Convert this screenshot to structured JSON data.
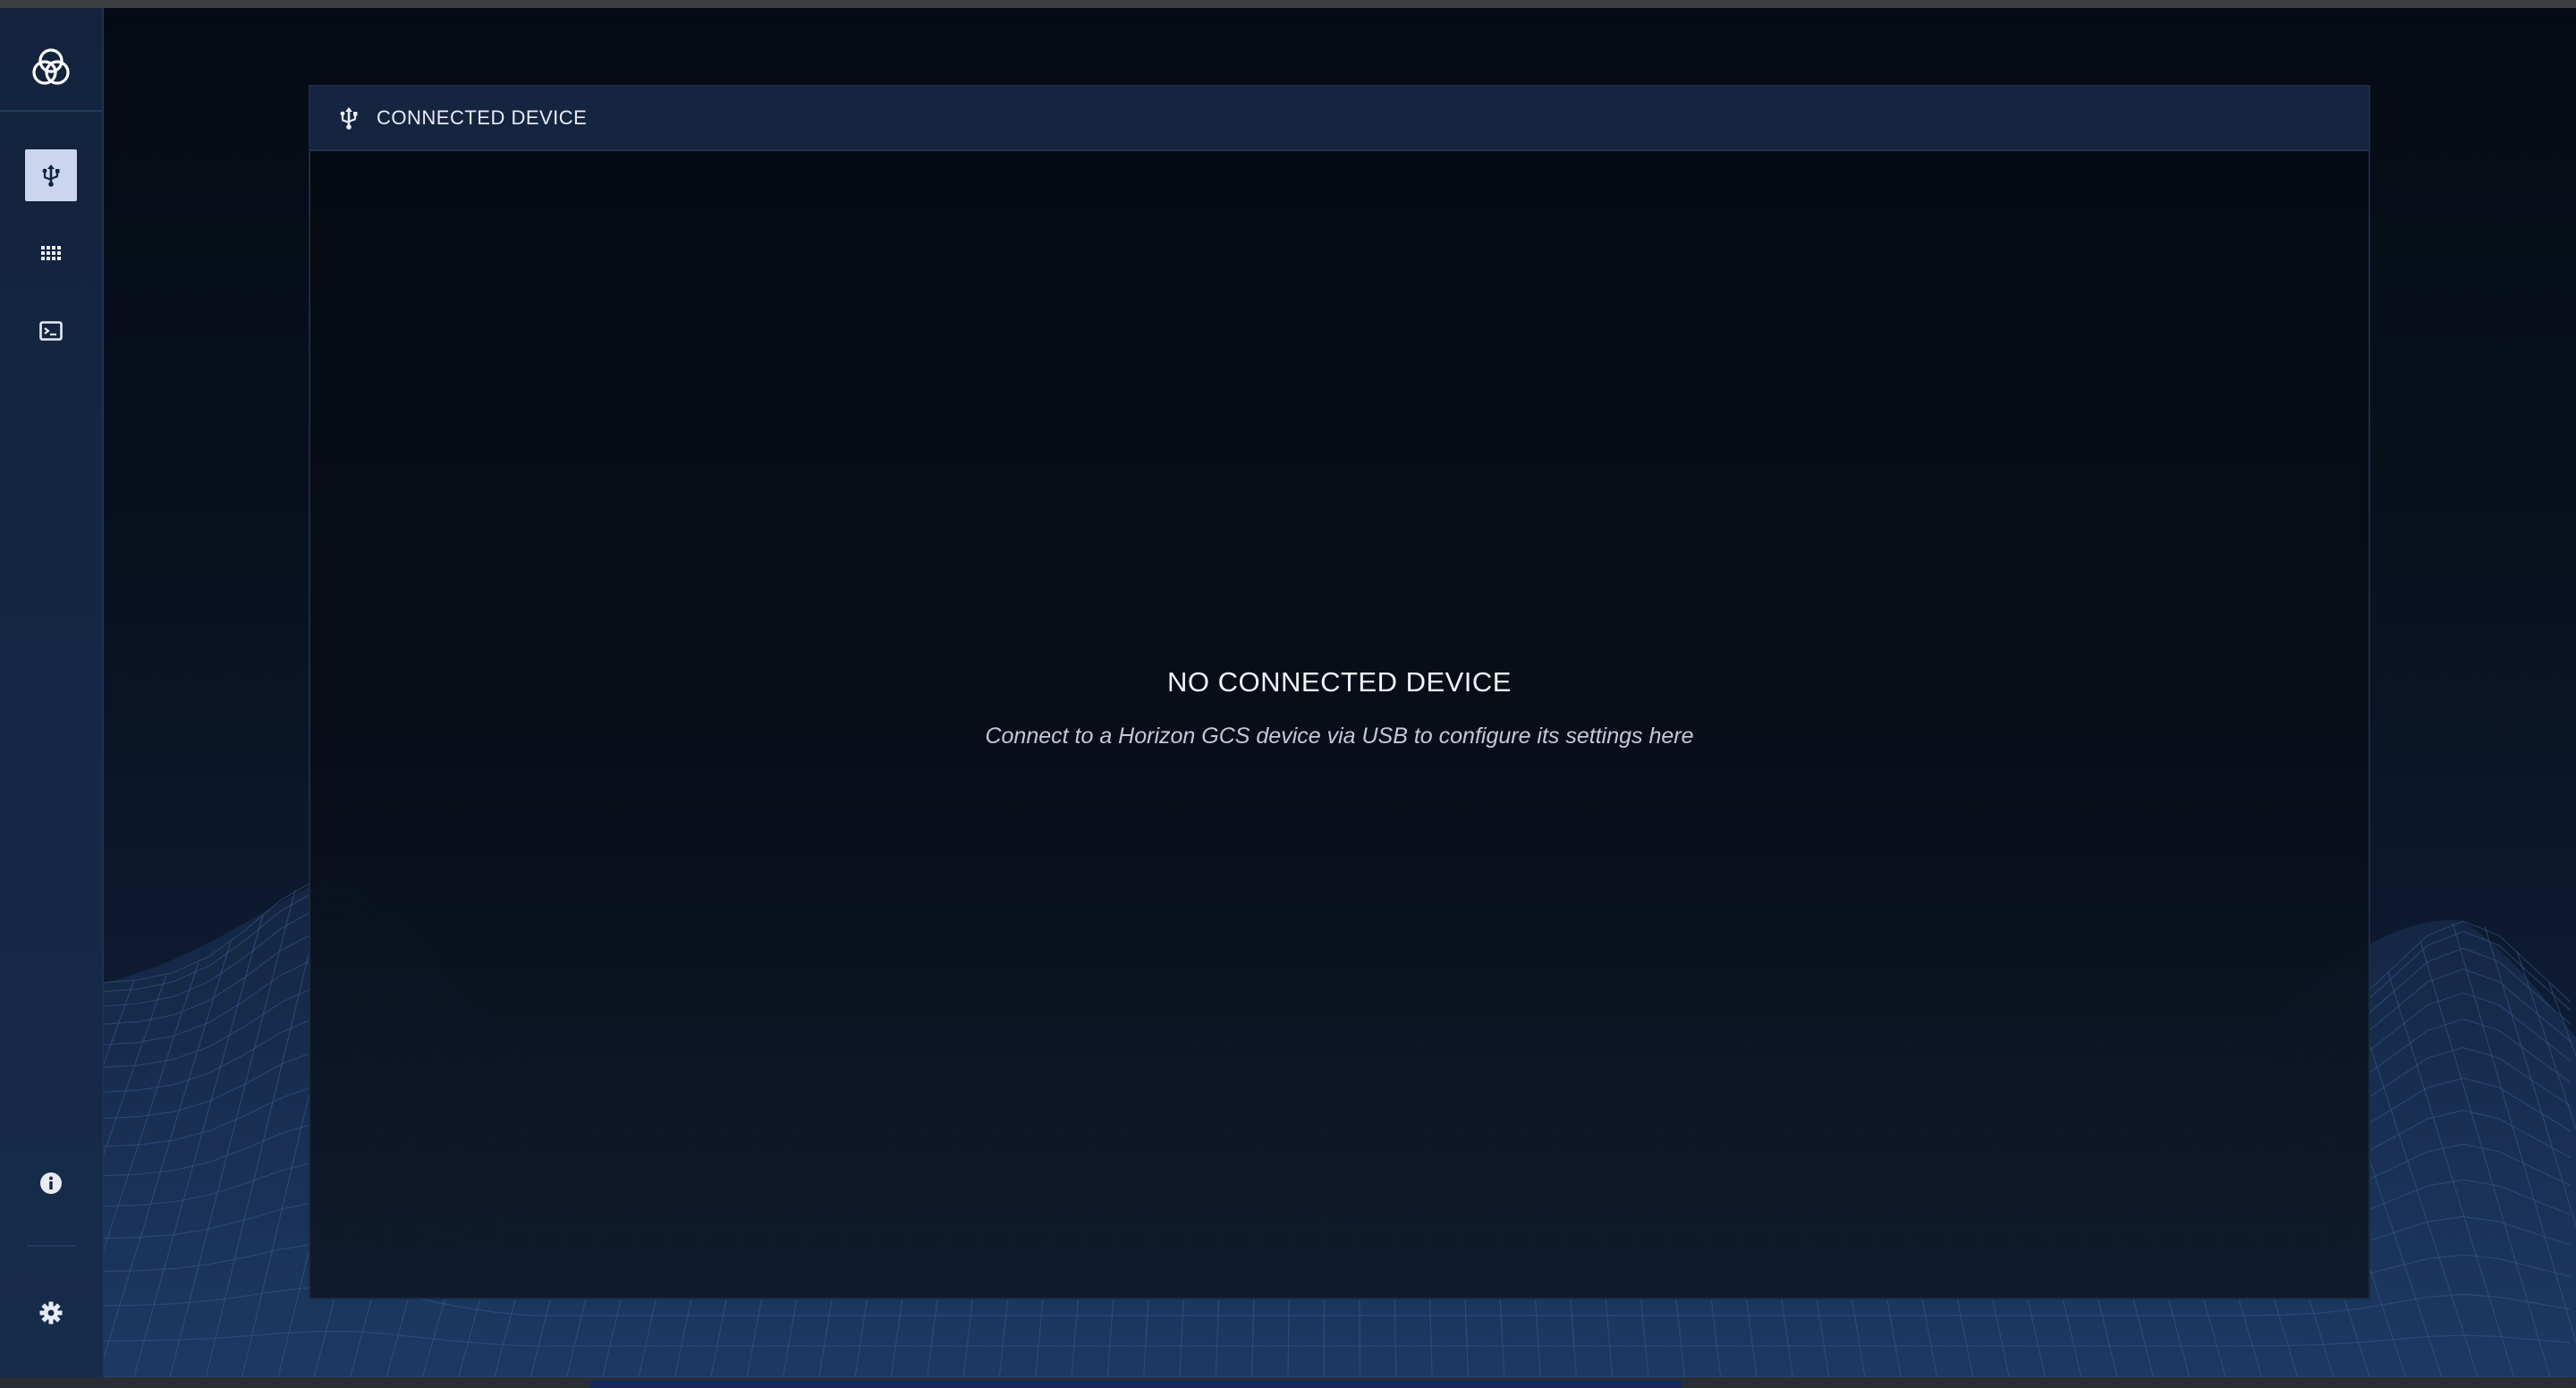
{
  "sidebar": {
    "logo_icon": "app-logo-icon",
    "items": [
      {
        "icon": "usb-icon",
        "active": true
      },
      {
        "icon": "grid-icon",
        "active": false
      },
      {
        "icon": "terminal-icon",
        "active": false
      }
    ],
    "bottom_items": [
      {
        "icon": "info-icon"
      },
      {
        "icon": "gear-icon"
      }
    ]
  },
  "panel": {
    "icon": "usb-icon",
    "title": "CONNECTED DEVICE",
    "empty_title": "NO CONNECTED DEVICE",
    "empty_message": "Connect to a Horizon GCS device via USB to configure its settings here"
  },
  "colors": {
    "background": "#0a1220",
    "sidebar": "#13233d",
    "panel_header": "#15243f",
    "active_nav": "#c9d6ee"
  }
}
